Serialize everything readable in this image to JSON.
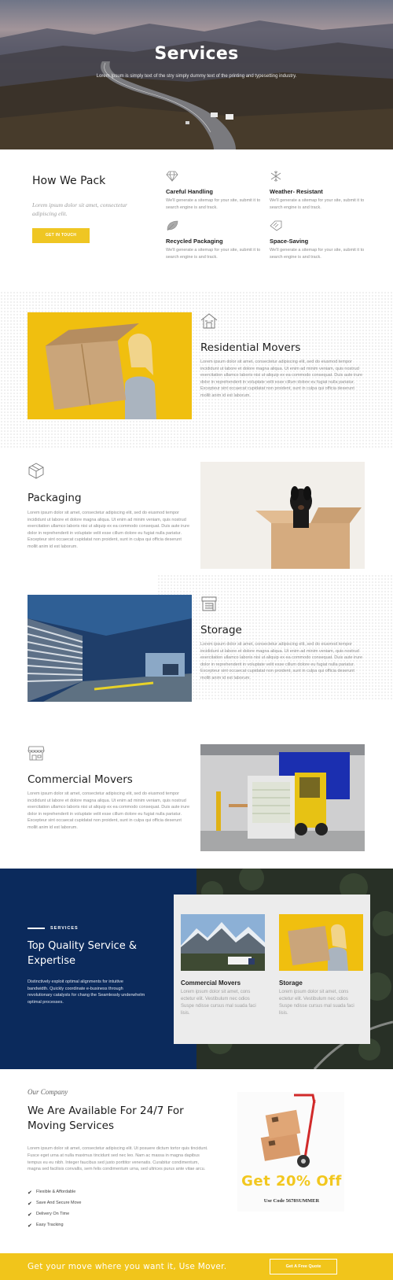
{
  "hero": {
    "title": "Services",
    "subtitle": "Lorem Ipsum is simply text of the stry simply dummy text of the printing and typesetting industry."
  },
  "pack": {
    "title": "How We Pack",
    "quote": "Lorem ipsum dolor sit amet, consectetur adipiscing elit.",
    "button": "GET IN TOUCH",
    "features": [
      {
        "icon": "diamond-icon",
        "title": "Careful Handling",
        "text": "We'll generate a sitemap for your site, submit it to search engine is and track."
      },
      {
        "icon": "snowflake-icon",
        "title": "Weather- Resistant",
        "text": "We'll generate a sitemap for your site, submit it to search engine is and track."
      },
      {
        "icon": "leaf-icon",
        "title": "Recycled Packaging",
        "text": "We'll generate a sitemap for your site, submit it to search engine is and track."
      },
      {
        "icon": "tag-icon",
        "title": "Space-Saving",
        "text": "We'll generate a sitemap for your site, submit it to search engine is and track."
      }
    ]
  },
  "services": [
    {
      "icon": "house-icon",
      "title": "Residential Movers",
      "text": "Lorem ipsum dolor sit amet, consectetur adipiscing elit, sed do eiusmod tempor incididunt ut labore et dolore magna aliqua. Ut enim ad minim veniam, quis nostrud exercitation ullamco laboris nisi ut aliquip ex ea commodo consequat. Duis aute irure dolor in reprehenderit in voluptate velit esse cillum dolore eu fugiat nulla pariatur. Excepteur sint occaecat cupidatat non proident, sunt in culpa qui officia deserunt mollit anim id est laborum."
    },
    {
      "icon": "box-icon",
      "title": "Packaging",
      "text": "Lorem ipsum dolor sit amet, consectetur adipiscing elit, sed do eiusmod tempor incididunt ut labore et dolore magna aliqua. Ut enim ad minim veniam, quis nostrud exercitation ullamco laboris nisi ut aliquip ex ea commodo consequat. Duis aute irure dolor in reprehenderit in voluptate velit esse cillum dolore eu fugiat nulla pariatur. Excepteur sint occaecat cupidatat non proident, sunt in culpa qui officia deserunt mollit anim id est laborum."
    },
    {
      "icon": "warehouse-icon",
      "title": "Storage",
      "text": "Lorem ipsum dolor sit amet, consectetur adipiscing elit, sed do eiusmod tempor incididunt ut labore et dolore magna aliqua. Ut enim ad minim veniam, quis nostrud exercitation ullamco laboris nisi ut aliquip ex ea commodo consequat. Duis aute irure dolor in reprehenderit in voluptate velit esse cillum dolore eu fugiat nulla pariatur. Excepteur sint occaecat cupidatat non proident, sunt in culpa qui officia deserunt mollit anim id est laborum."
    },
    {
      "icon": "store-icon",
      "title": "Commercial Movers",
      "text": "Lorem ipsum dolor sit amet, consectetur adipiscing elit, sed do eiusmod tempor incididunt ut labore et dolore magna aliqua. Ut enim ad minim veniam, quis nostrud exercitation ullamco laboris nisi ut aliquip ex ea commodo consequat. Duis aute irure dolor in reprehenderit in voluptate velit esse cillum dolore eu fugiat nulla pariatur. Excepteur sint occaecat cupidatat non proident, sunt in culpa qui officia deserunt mollit anim id est laborum."
    }
  ],
  "quality": {
    "label": "SERVICES",
    "title": "Top Quality Service & Expertise",
    "text": "Distinctively exploit optimal alignments for intuitive bandwidth. Quickly coordinate e-business through revolutionary catalysts for chang the Seamlessly underwhelm optimal processes.",
    "cards": [
      {
        "title": "Commercial Movers",
        "text": "Lorem ipsum dolor sit amet, cons ectetur elit. Vestibulum nec odios Suspe ndisse cursus mal suada faci lisis."
      },
      {
        "title": "Storage",
        "text": "Lorem ipsum dolor sit amet, cons ectetur elit. Vestibulum nec odios Suspe ndisse cursus mal suada faci lisis."
      }
    ]
  },
  "company": {
    "eyebrow": "Our Company",
    "title": "We Are Available For 24/7 For Moving Services",
    "text": "Lorem ipsum dolor sit amet, consectetur adipiscing elit. Ut posuere dictum tortor quis tincidunt. Fusce eget urna at nulla maximus tincidunt sed nec leo. Nam ac massa in magna dapibus tempus eu eu nibh. Integer faucibus sed justo porttitor venenatis. Curabitur condimentum, magna sed facilisis convallis, sem felis condimentum urna, sed ultrices purus ante vitae arcu.",
    "checks": [
      "Flexible & Affordable",
      "Save And Secure Move",
      "Delivery On Time",
      "Easy Tracking"
    ]
  },
  "promo": {
    "headline": "Get 20% Off",
    "code": "Use Code 5678SUMMER"
  },
  "bar": {
    "text": "Get your move where you want it, Use Mover.",
    "button": "Get A Free Quote"
  },
  "colors": {
    "accent": "#f1c51b",
    "navy": "#0b2a5c"
  }
}
